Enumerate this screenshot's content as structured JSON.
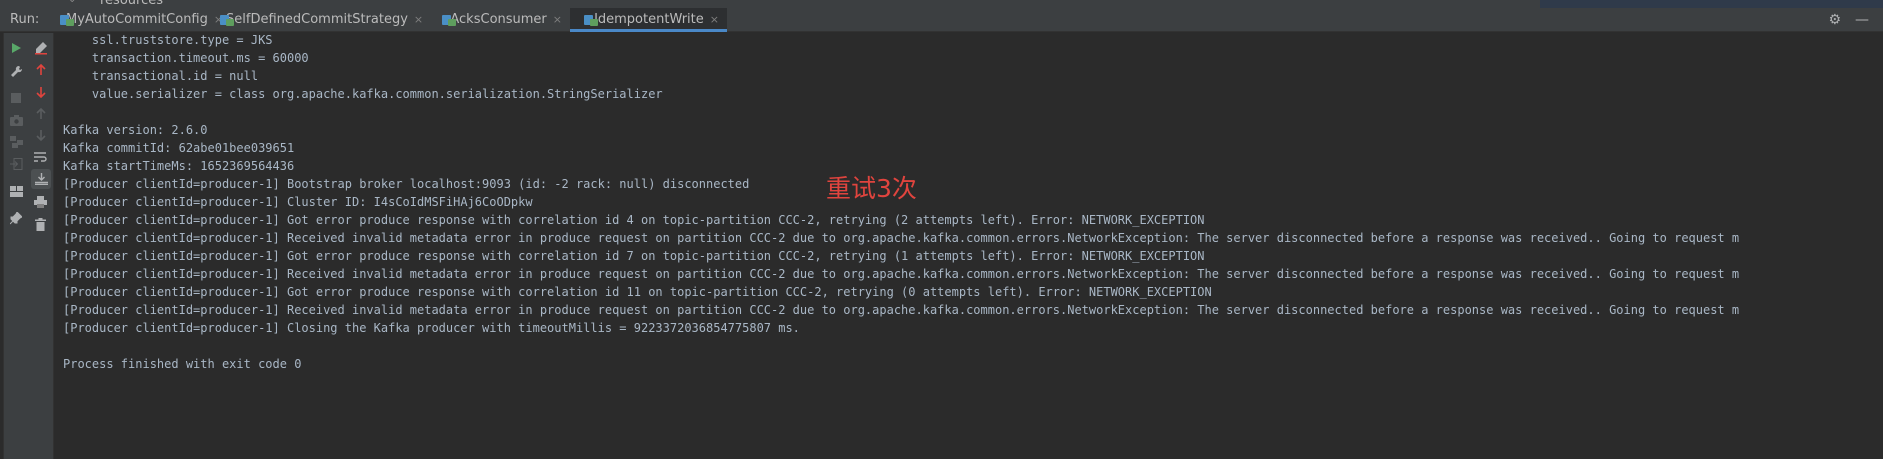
{
  "project_tree": {
    "collapse_arrow": "chevron-down-icon",
    "visible_item": "resources"
  },
  "run_bar": {
    "label": "Run:",
    "tabs": [
      {
        "label": "MyAutoCommitConfig",
        "active": false
      },
      {
        "label": "SelfDefinedCommitStrategy",
        "active": false
      },
      {
        "label": "AcksConsumer",
        "active": false
      },
      {
        "label": "IdempotentWrite",
        "active": true
      }
    ],
    "close_glyph": "×",
    "settings_icon": "gear-icon",
    "hide_icon": "minimize-icon"
  },
  "toolbar_icons": {
    "left": [
      "rerun-icon",
      "wrench-icon",
      "stop-icon",
      "camera-icon",
      "threads-icon",
      "login-icon",
      "layout-icon",
      "pin-icon"
    ],
    "right": [
      "clear-icon",
      "up-arrow-icon",
      "down-arrow-icon",
      "up-arrow-disabled-icon",
      "down-arrow-disabled-icon",
      "soft-wrap-icon",
      "scroll-to-end-icon",
      "print-icon",
      "trash-icon"
    ]
  },
  "console": {
    "lines": [
      "    ssl.truststore.type = JKS",
      "    transaction.timeout.ms = 60000",
      "    transactional.id = null",
      "    value.serializer = class org.apache.kafka.common.serialization.StringSerializer",
      "",
      "Kafka version: 2.6.0",
      "Kafka commitId: 62abe01bee039651",
      "Kafka startTimeMs: 1652369564436",
      "[Producer clientId=producer-1] Bootstrap broker localhost:9093 (id: -2 rack: null) disconnected",
      "[Producer clientId=producer-1] Cluster ID: I4sCoIdMSFiHAj6CoODpkw",
      "[Producer clientId=producer-1] Got error produce response with correlation id 4 on topic-partition CCC-2, retrying (2 attempts left). Error: NETWORK_EXCEPTION",
      "[Producer clientId=producer-1] Received invalid metadata error in produce request on partition CCC-2 due to org.apache.kafka.common.errors.NetworkException: The server disconnected before a response was received.. Going to request m",
      "[Producer clientId=producer-1] Got error produce response with correlation id 7 on topic-partition CCC-2, retrying (1 attempts left). Error: NETWORK_EXCEPTION",
      "[Producer clientId=producer-1] Received invalid metadata error in produce request on partition CCC-2 due to org.apache.kafka.common.errors.NetworkException: The server disconnected before a response was received.. Going to request m",
      "[Producer clientId=producer-1] Got error produce response with correlation id 11 on topic-partition CCC-2, retrying (0 attempts left). Error: NETWORK_EXCEPTION",
      "[Producer clientId=producer-1] Received invalid metadata error in produce request on partition CCC-2 due to org.apache.kafka.common.errors.NetworkException: The server disconnected before a response was received.. Going to request m",
      "[Producer clientId=producer-1] Closing the Kafka producer with timeoutMillis = 9223372036854775807 ms.",
      "",
      "Process finished with exit code 0"
    ],
    "annotation": "重试3次"
  },
  "colors": {
    "background": "#2b2b2b",
    "toolbar": "#3c3f41",
    "text": "#a9b7c6",
    "annotation": "#e0443e",
    "tab_underline": "#4a88c7"
  }
}
